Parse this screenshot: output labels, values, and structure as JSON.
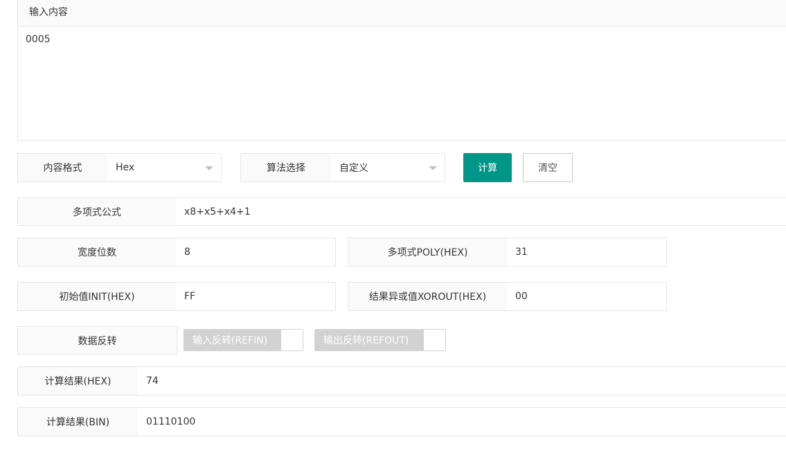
{
  "input": {
    "title": "输入内容",
    "value": "0005"
  },
  "controls": {
    "format_label": "内容格式",
    "format_value": "Hex",
    "algorithm_label": "算法选择",
    "algorithm_value": "自定义",
    "calc_button": "计算",
    "clear_button": "清空"
  },
  "params": {
    "poly_formula_label": "多项式公式",
    "poly_formula_value": "x8+x5+x4+1",
    "width_label": "宽度位数",
    "width_value": "8",
    "poly_hex_label": "多项式POLY(HEX)",
    "poly_hex_value": "31",
    "init_label": "初始值INIT(HEX)",
    "init_value": "FF",
    "xorout_label": "结果异或值XOROUT(HEX)",
    "xorout_value": "00",
    "reverse_label": "数据反转",
    "refin_label": "输入反转(REFIN)",
    "refout_label": "输出反转(REFOUT)"
  },
  "results": {
    "hex_label": "计算结果(HEX)",
    "hex_value": "74",
    "bin_label": "计算结果(BIN)",
    "bin_value": "01110100"
  },
  "colors": {
    "accent": "#009688",
    "label_bg": "#fafafa",
    "border": "#e6e6e6",
    "switch_disabled": "#d2d2d2"
  }
}
